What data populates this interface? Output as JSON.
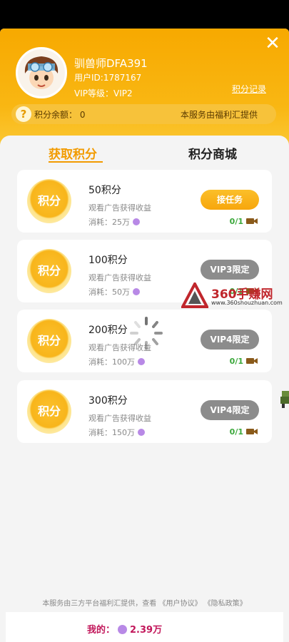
{
  "header": {
    "username": "驯兽师DFA391",
    "user_id": "用户ID:1787167",
    "vip_level": "VIP等级：VIP2",
    "record_link": "积分记录",
    "balance": "积分余额： 0",
    "provider_note": "本服务由福利汇提供",
    "close_icon": "close-icon"
  },
  "tabs": [
    {
      "label": "获取积分",
      "active": true
    },
    {
      "label": "积分商城",
      "active": false
    }
  ],
  "tasks": [
    {
      "coin": "积分",
      "title": "50积分",
      "desc": "观看广告获得收益",
      "cost": "消耗：25万",
      "button": "接任务",
      "button_kind": "go",
      "progress": "0/1"
    },
    {
      "coin": "积分",
      "title": "100积分",
      "desc": "观看广告获得收益",
      "cost": "消耗：50万",
      "button": "VIP3限定",
      "button_kind": "lock",
      "progress": "0/1"
    },
    {
      "coin": "积分",
      "title": "200积分",
      "desc": "观看广告获得收益",
      "cost": "消耗：100万",
      "button": "VIP4限定",
      "button_kind": "lock",
      "progress": "0/1"
    },
    {
      "coin": "积分",
      "title": "300积分",
      "desc": "观看广告获得收益",
      "cost": "消耗：150万",
      "button": "VIP4限定",
      "button_kind": "lock",
      "progress": "0/1"
    }
  ],
  "watermark": {
    "text": "360手赚网",
    "url": "www.360shouzhuan.com"
  },
  "footer": {
    "note": "本服务由三方平台福利汇提供，查看 《用户协议》 《隐私政策》",
    "mine_label": "我的：",
    "mine_value": "2.39万"
  },
  "colors": {
    "accent": "#f29b00",
    "header": "#f9b713",
    "locked": "#8c8c8c",
    "progress": "#3aa83a"
  }
}
